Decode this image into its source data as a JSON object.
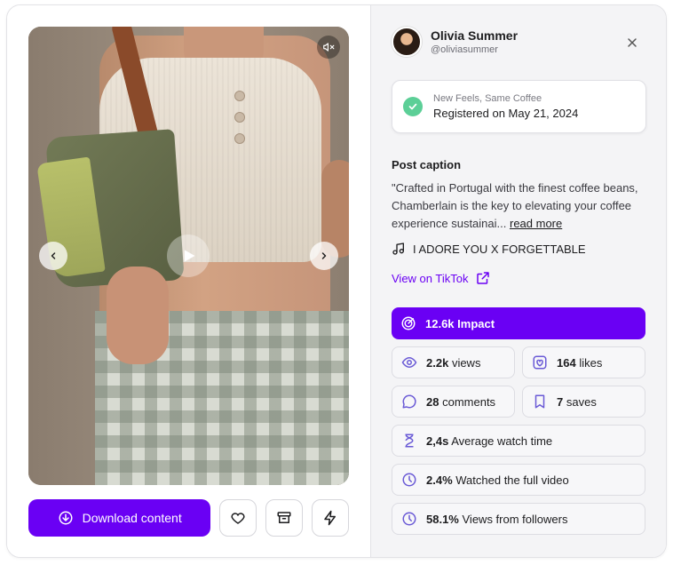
{
  "player": {
    "mute_icon": "speaker-mute-icon",
    "prev_icon": "chevron-left-icon",
    "next_icon": "chevron-right-icon",
    "play_icon": "play-icon"
  },
  "actions": {
    "download_label": "Download content",
    "like_icon": "heart-icon",
    "archive_icon": "archive-icon",
    "boost_icon": "lightning-icon"
  },
  "profile": {
    "name": "Olivia Summer",
    "handle": "@oliviasummer"
  },
  "registration": {
    "title": "New Feels, Same Coffee",
    "date": "Registered on May 21, 2024"
  },
  "caption": {
    "heading": "Post caption",
    "text": "\"Crafted in Portugal with the finest coffee beans, Chamberlain is the key to elevating your coffee experience sustainai...",
    "read_more": "read more"
  },
  "music": {
    "track": "I ADORE YOU X FORGETTABLE"
  },
  "tiktok_link": "View on TikTok",
  "impact": {
    "value": "12.6k",
    "label": "Impact"
  },
  "stats": {
    "views": {
      "value": "2.2k",
      "label": "views"
    },
    "likes": {
      "value": "164",
      "label": "likes"
    },
    "comments": {
      "value": "28",
      "label": "comments"
    },
    "saves": {
      "value": "7",
      "label": "saves"
    },
    "watch_time": {
      "value": "2,4s",
      "label": "Average watch time"
    },
    "full_video": {
      "value": "2.4%",
      "label": "Watched the full video"
    },
    "followers": {
      "value": "58.1%",
      "label": "Views from followers"
    }
  },
  "colors": {
    "accent": "#6a00f4",
    "success": "#5ccf97",
    "panel_bg": "#f4f4f6"
  }
}
